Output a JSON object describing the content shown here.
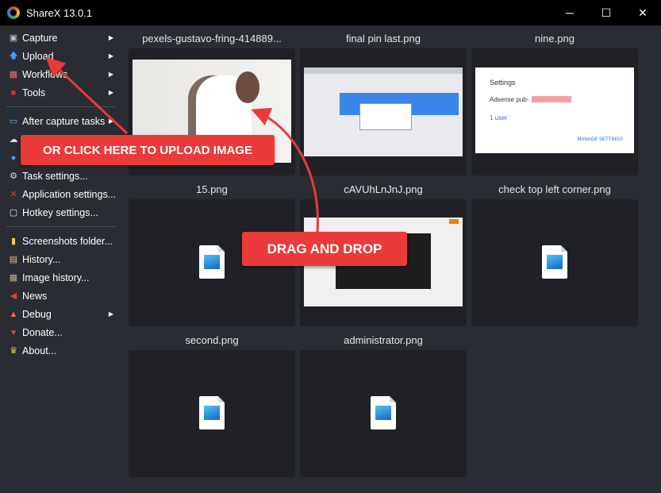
{
  "window": {
    "title": "ShareX 13.0.1",
    "minimize": "─",
    "maximize": "☐",
    "close": "✕"
  },
  "menu": {
    "group1": [
      {
        "label": "Capture",
        "icon": "camera-icon",
        "sub": true
      },
      {
        "label": "Upload",
        "icon": "upload-arrow-icon",
        "sub": true
      },
      {
        "label": "Workflows",
        "icon": "workflows-grid-icon",
        "sub": true
      },
      {
        "label": "Tools",
        "icon": "toolbox-icon",
        "sub": true
      }
    ],
    "group2": [
      {
        "label": "After capture tasks",
        "icon": "after-capture-icon",
        "sub": true
      },
      {
        "label": "",
        "icon": "cloud-upload-icon"
      },
      {
        "label": "",
        "icon": "destinations-icon"
      },
      {
        "label": "Task settings...",
        "icon": "gear-icon"
      },
      {
        "label": "Application settings...",
        "icon": "wrench-icon"
      },
      {
        "label": "Hotkey settings...",
        "icon": "keyboard-icon"
      }
    ],
    "group3": [
      {
        "label": "Screenshots folder...",
        "icon": "folder-icon"
      },
      {
        "label": "History...",
        "icon": "history-icon"
      },
      {
        "label": "Image history...",
        "icon": "image-history-icon"
      },
      {
        "label": "News",
        "icon": "megaphone-icon"
      },
      {
        "label": "Debug",
        "icon": "cone-icon",
        "sub": true
      },
      {
        "label": "Donate...",
        "icon": "heart-icon"
      },
      {
        "label": "About...",
        "icon": "crown-icon"
      }
    ]
  },
  "files": [
    {
      "name": "pexels-gustavo-fring-414889...",
      "thumb": "photo"
    },
    {
      "name": "final pin last.png",
      "thumb": "screenshot"
    },
    {
      "name": "nine.png",
      "thumb": "settings"
    },
    {
      "name": "15.png",
      "thumb": "placeholder"
    },
    {
      "name": "cAVUhLnJnJ.png",
      "thumb": "screenshot-dark"
    },
    {
      "name": "check top left corner.png",
      "thumb": "placeholder"
    },
    {
      "name": "second.png",
      "thumb": "placeholder"
    },
    {
      "name": "administrator.png",
      "thumb": "placeholder"
    }
  ],
  "nine_thumb": {
    "title": "Settings",
    "line": "Adsense pub-",
    "link": "1 user",
    "button": "MANAGE SETTINGS"
  },
  "annotations": {
    "upload_callout": "OR CLICK HERE TO UPLOAD IMAGE",
    "drag_callout": "DRAG AND DROP",
    "color": "#ea3a3a"
  }
}
